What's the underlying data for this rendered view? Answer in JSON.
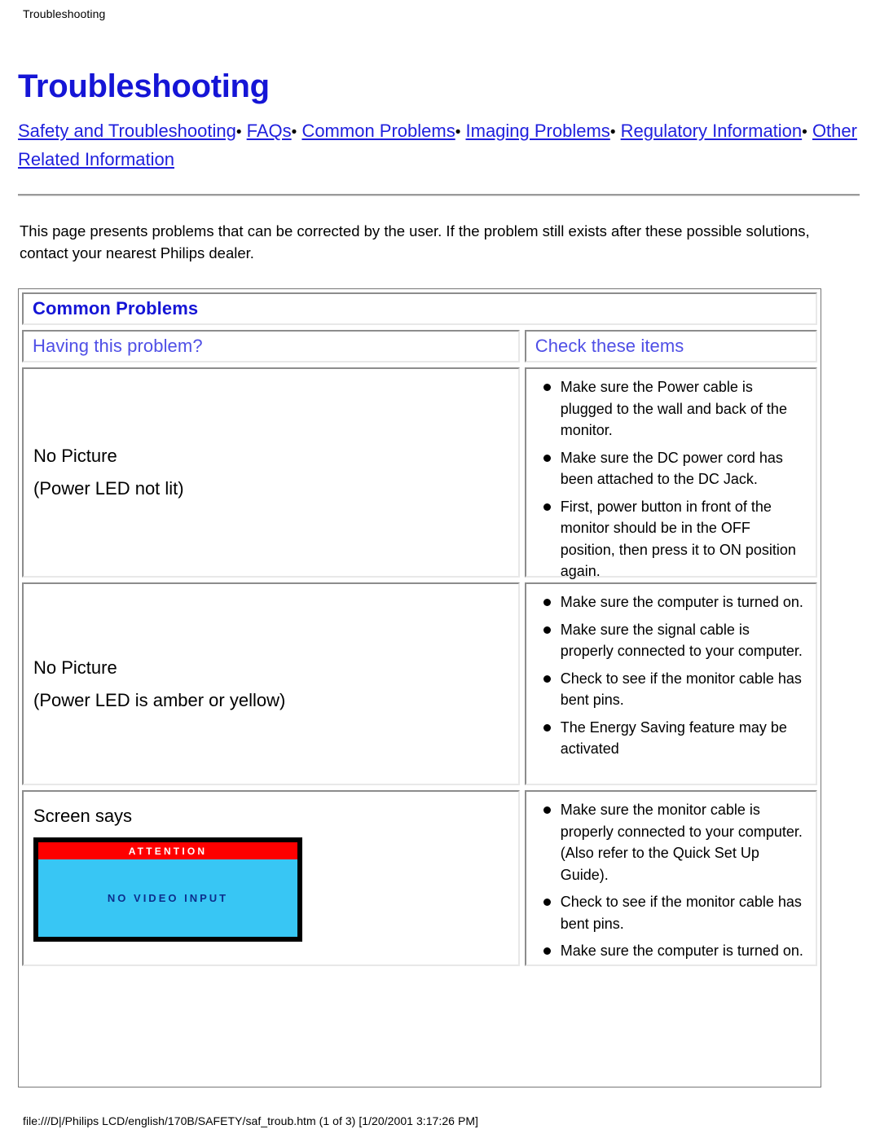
{
  "page": {
    "running_header": "Troubleshooting",
    "title": "Troubleshooting",
    "footer": "file:///D|/Philips LCD/english/170B/SAFETY/saf_troub.htm (1 of 3) [1/20/2001 3:17:26 PM]"
  },
  "nav": {
    "separator": "•",
    "links": [
      "Safety and Troubleshooting",
      "FAQs",
      "Common Problems",
      "Imaging Problems",
      "Regulatory Information",
      "Other Related Information"
    ]
  },
  "intro": "This page presents problems that can be corrected by the user. If the problem still exists after these possible solutions, contact your nearest Philips dealer.",
  "table": {
    "caption": "Common Problems",
    "headers": {
      "problem": "Having this problem?",
      "items": "Check these items"
    },
    "rows": [
      {
        "problem_lines": [
          "No Picture",
          "(Power LED not lit)"
        ],
        "items": [
          "Make sure the Power cable is plugged to the wall and back of the monitor.",
          "Make sure the DC power cord has been attached to the DC Jack.",
          "First, power button in front of the monitor should be in the OFF position, then press it to ON position again."
        ]
      },
      {
        "problem_lines": [
          "No Picture",
          "(Power LED is amber or yellow)"
        ],
        "items": [
          "Make sure the computer is turned on.",
          "Make sure the signal cable is properly connected to your computer.",
          "Check to see if the monitor cable has bent pins.",
          "The Energy Saving feature may be activated"
        ]
      },
      {
        "problem_lines": [
          "Screen says"
        ],
        "osd": {
          "title": "ATTENTION",
          "message": "NO VIDEO INPUT",
          "bar_color": "#fe0000",
          "screen_color": "#38c6f4",
          "title_color": "#ffffff",
          "message_color": "#0d2e8c"
        },
        "items": [
          "Make sure the monitor cable is properly connected to your computer. (Also refer to the Quick Set Up Guide).",
          "Check to see if the monitor cable has bent pins.",
          "Make sure the computer is turned on."
        ]
      }
    ]
  },
  "colors": {
    "heading_blue": "#1515d6",
    "link_blue": "#1f1fdd",
    "subheader_blue": "#4f4fe6"
  }
}
